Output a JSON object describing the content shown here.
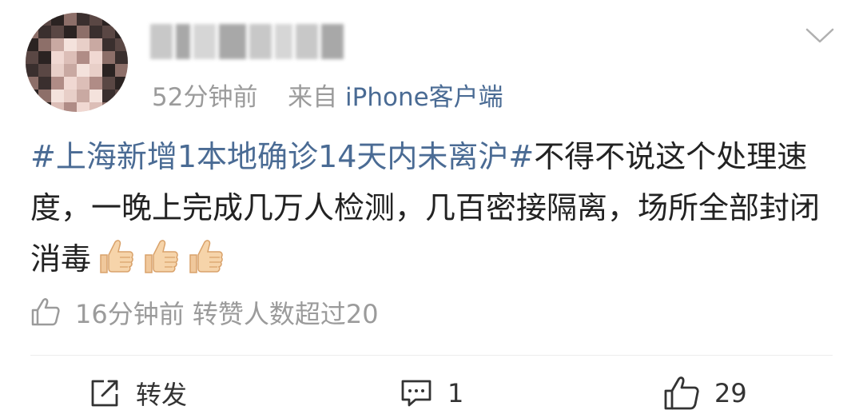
{
  "post": {
    "time": "52分钟前",
    "source_prefix": "来自",
    "source": "iPhone客户端",
    "topic": "#上海新增1本地确诊14天内未离沪#",
    "body": "不得不说这个处理速度，一晚上完成几万人检测，几百密接隔离，场所全部封闭消毒",
    "emojis": [
      "thumbs-up-emoji",
      "thumbs-up-emoji",
      "thumbs-up-emoji"
    ],
    "repost_note": "16分钟前 转赞人数超过20"
  },
  "actions": {
    "repost_label": "转发",
    "comment_count": "1",
    "like_count": "29"
  },
  "icons": {
    "menu": "chevron-down-icon",
    "repost": "share-icon",
    "comment": "comment-icon",
    "like": "thumbs-up-icon"
  },
  "colors": {
    "link": "#4a6b94",
    "meta": "#9b9b9b",
    "text": "#222222"
  }
}
